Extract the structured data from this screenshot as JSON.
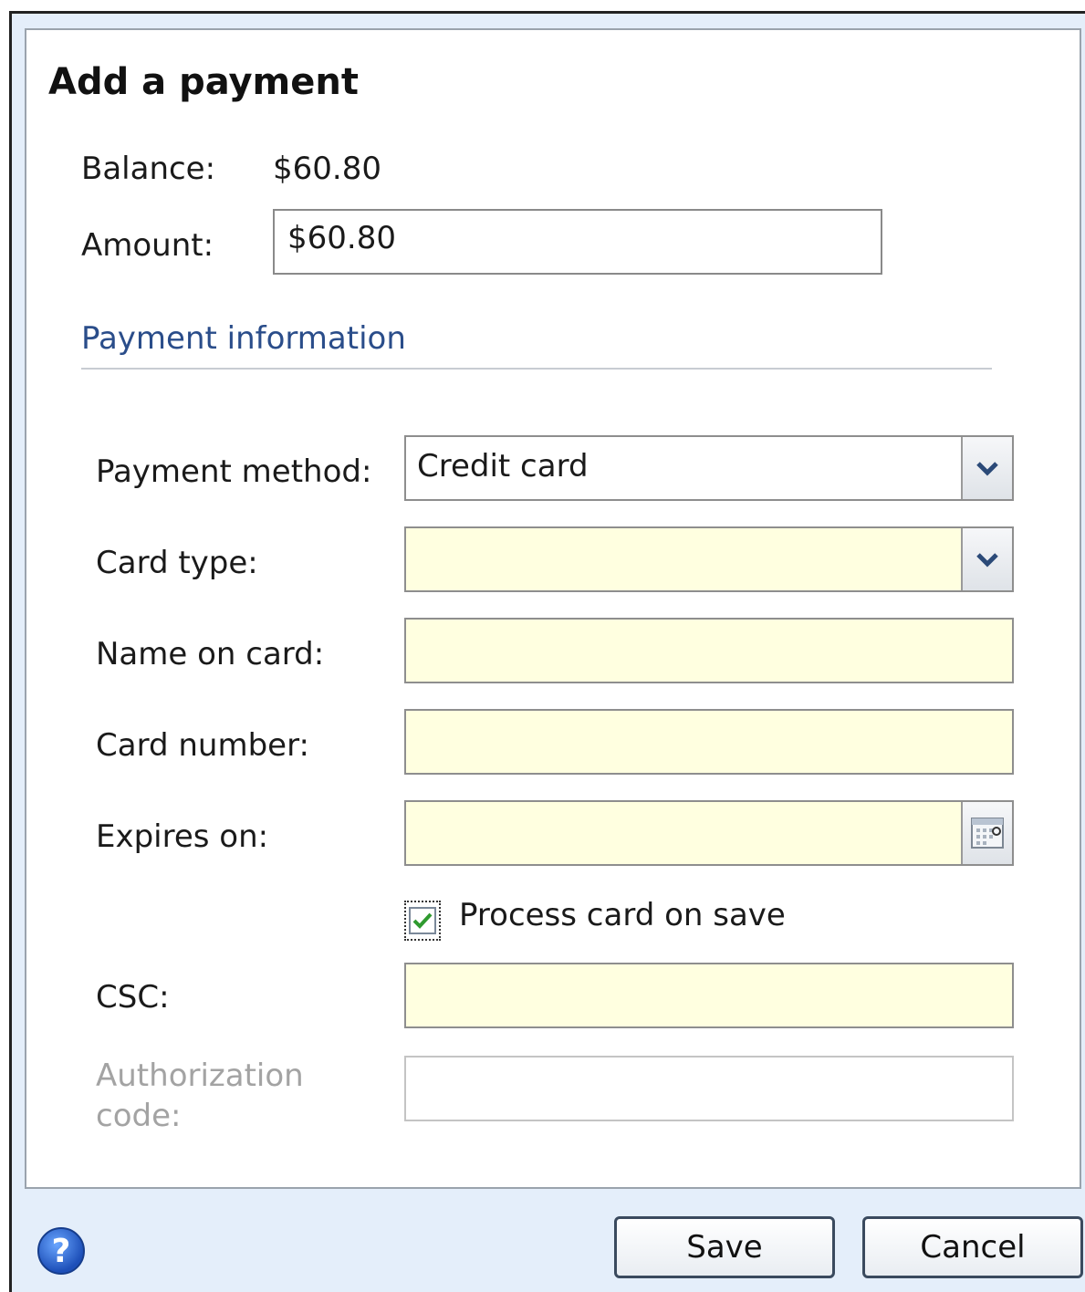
{
  "dialog": {
    "title": "Add a payment",
    "balance_label": "Balance:",
    "balance_value": "$60.80",
    "amount_label": "Amount:",
    "amount_value": "$60.80"
  },
  "payment_info": {
    "section_title": "Payment information",
    "payment_method_label": "Payment method:",
    "payment_method_value": "Credit card",
    "card_type_label": "Card type:",
    "card_type_value": "",
    "name_on_card_label": "Name on card:",
    "name_on_card_value": "",
    "card_number_label": "Card number:",
    "card_number_value": "",
    "expires_on_label": "Expires on:",
    "expires_on_value": "",
    "process_card_label": "Process card on save",
    "process_card_checked": true,
    "csc_label": "CSC:",
    "csc_value": "",
    "authorization_code_label": "Authorization code:",
    "authorization_code_value": ""
  },
  "footer": {
    "save_label": "Save",
    "cancel_label": "Cancel",
    "help_glyph": "?"
  },
  "icons": {
    "dropdown": "chevron-down-icon",
    "calendar": "calendar-icon",
    "checkmark": "checkmark-icon",
    "help": "help-icon"
  },
  "colors": {
    "required_field_bg": "#ffffe0",
    "section_title": "#2a4d8a",
    "dialog_footer_bg": "#e4eefa"
  }
}
